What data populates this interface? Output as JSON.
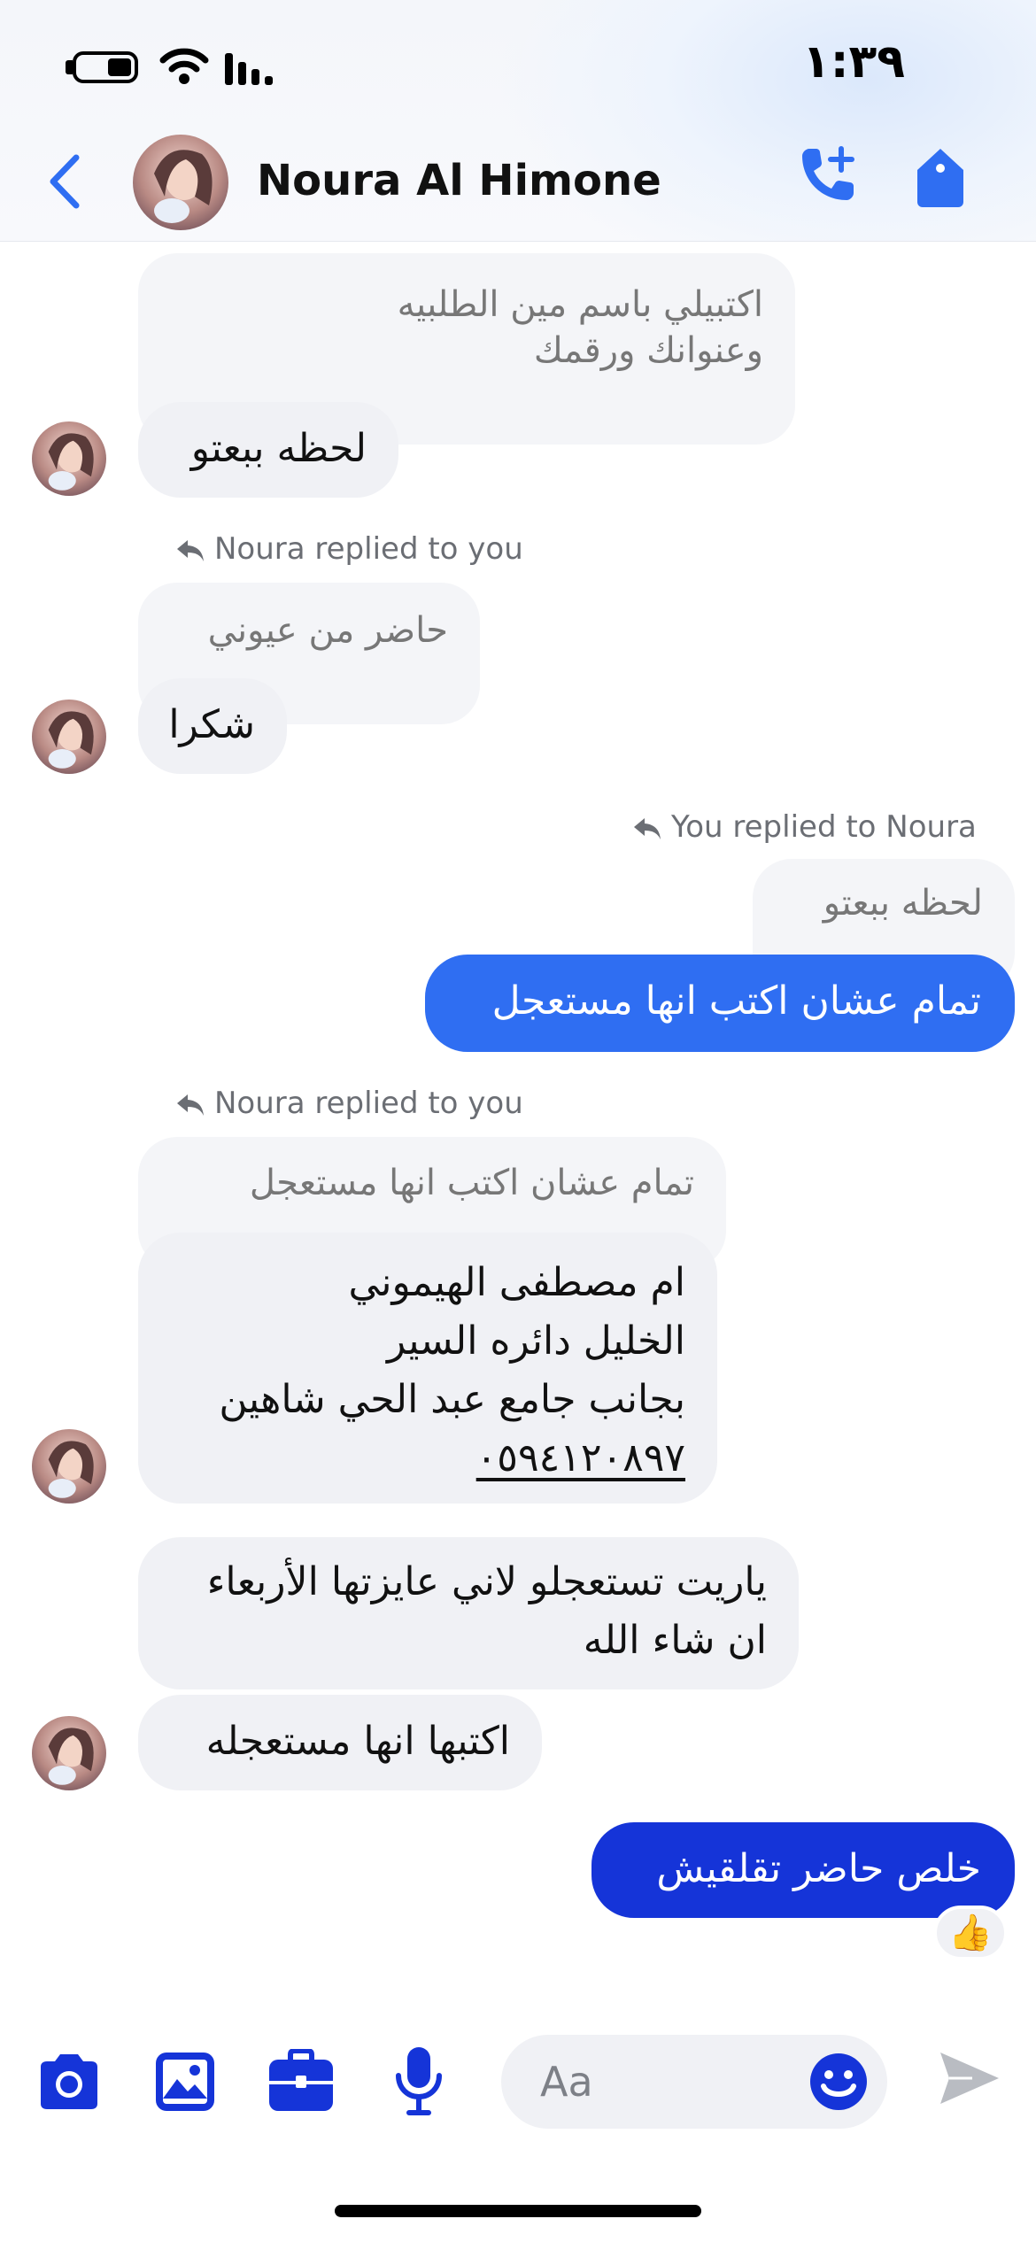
{
  "status_bar": {
    "time": "١:٣٩"
  },
  "header": {
    "contact_name": "Noura Al Himone"
  },
  "messages": {
    "q1_line1": "اكتبيلي باسم مين الطلبيه",
    "q1_line2": "وعنوانك ورقمك",
    "m1": "لحظه ببعتو",
    "reply_label_1": "Noura replied to you",
    "q2": "حاضر من عيوني",
    "m2": "شكرا",
    "reply_label_2": "You replied to Noura",
    "q3": "لحظه ببعتو",
    "m3": "تمام عشان اكتب انها مستعجل",
    "reply_label_3": "Noura replied to you",
    "q4": "تمام عشان اكتب انها مستعجل",
    "m4_line1": "ام مصطفى الهيموني",
    "m4_line2": "الخليل دائره السير",
    "m4_line3": "بجانب جامع عبد الحي شاهين",
    "m4_phone": "٠٥٩٤١٢٠٨٩٧",
    "m5_line1": "ياريت تستعجلو لاني عايزتها الأربعاء",
    "m5_line2": "ان شاء الله",
    "m6": "اكتبها انها مستعجله",
    "m7": "خلص حاضر تقلقيش",
    "m7_reaction": "👍"
  },
  "composer": {
    "placeholder": "Aa"
  },
  "icons": [
    "back-chevron-icon",
    "audio-call-add-icon",
    "tag-icon",
    "camera-icon",
    "gallery-icon",
    "briefcase-icon",
    "microphone-icon",
    "emoji-icon",
    "send-icon"
  ],
  "colors": {
    "accent": "#2f6ef2",
    "accent_dark": "#1534d8",
    "bubble_in": "#f0f1f5"
  }
}
